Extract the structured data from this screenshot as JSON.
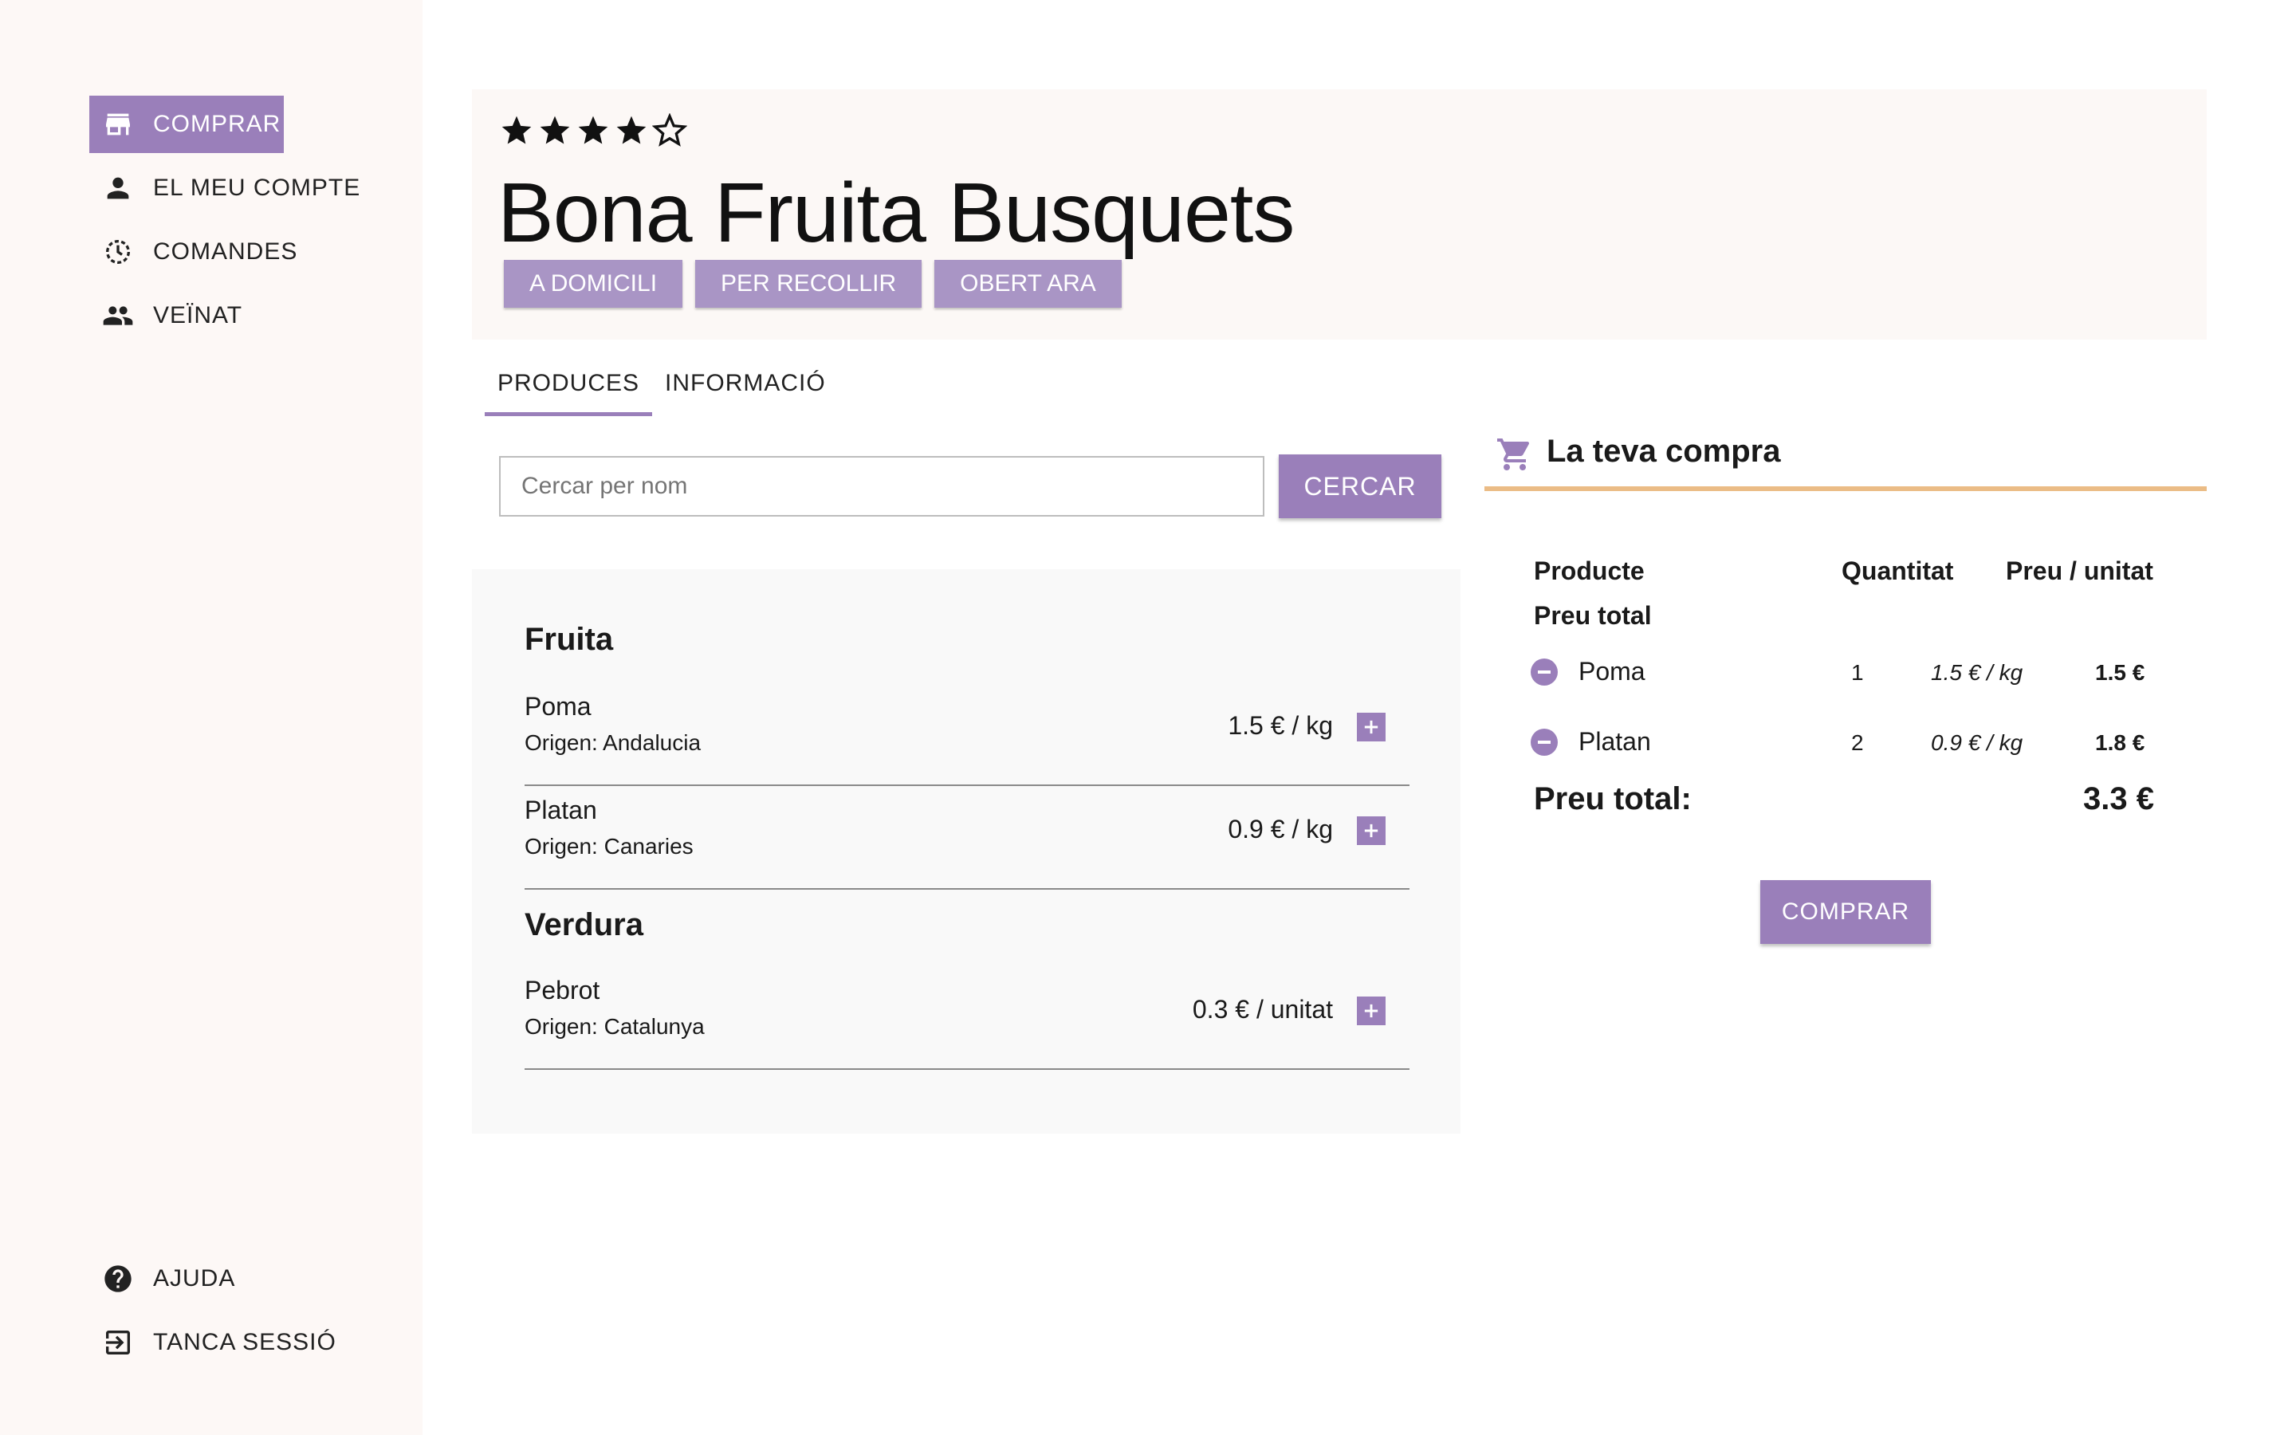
{
  "sidebar": {
    "items": [
      {
        "label": "COMPRAR",
        "icon": "store-icon"
      },
      {
        "label": "EL MEU COMPTE",
        "icon": "person-icon"
      },
      {
        "label": "COMANDES",
        "icon": "history-icon"
      },
      {
        "label": "VEÏNAT",
        "icon": "people-icon"
      }
    ],
    "bottom": [
      {
        "label": "AJUDA",
        "icon": "help-icon"
      },
      {
        "label": "TANCA SESSIÓ",
        "icon": "logout-icon"
      }
    ]
  },
  "shop": {
    "rating": 4,
    "rating_max": 5,
    "name": "Bona Fruita Busquets",
    "chips": [
      "A DOMICILI",
      "PER RECOLLIR",
      "OBERT ARA"
    ]
  },
  "tabs": [
    {
      "label": "PRODUCES",
      "active": true
    },
    {
      "label": "INFORMACIÓ",
      "active": false
    }
  ],
  "search": {
    "placeholder": "Cercar per nom",
    "value": "",
    "button_label": "CERCAR"
  },
  "catalog": {
    "categories": [
      {
        "name": "Fruita",
        "products": [
          {
            "name": "Poma",
            "origin": "Origen: Andalucia",
            "price": "1.5 € / kg"
          },
          {
            "name": "Platan",
            "origin": "Origen: Canaries",
            "price": "0.9 € / kg"
          }
        ]
      },
      {
        "name": "Verdura",
        "products": [
          {
            "name": "Pebrot",
            "origin": "Origen: Catalunya",
            "price": "0.3 € / unitat"
          }
        ]
      }
    ]
  },
  "cart": {
    "title": "La teva compra",
    "headers": {
      "product": "Producte",
      "quantity": "Quantitat",
      "unit_price": "Preu / unitat",
      "total": "Preu total"
    },
    "items": [
      {
        "name": "Poma",
        "quantity": "1",
        "unit_price": "1.5 € / kg",
        "total": "1.5 €"
      },
      {
        "name": "Platan",
        "quantity": "2",
        "unit_price": "0.9 € / kg",
        "total": "1.8 €"
      }
    ],
    "total_label": "Preu total:",
    "total_value": "3.3 €",
    "buy_label": "COMPRAR"
  },
  "colors": {
    "accent": "#9a7fba",
    "chip": "#a995c5",
    "cart_underline": "#ebbc86",
    "sidebar_bg": "#fdf8f6"
  }
}
